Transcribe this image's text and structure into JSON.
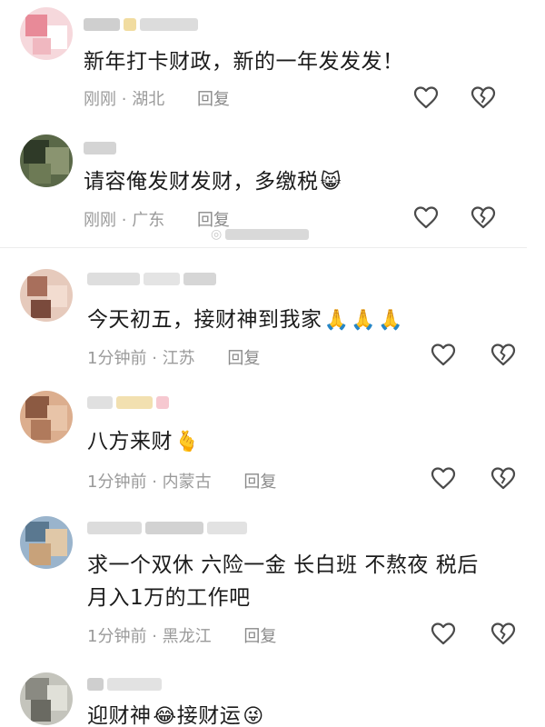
{
  "comments": [
    {
      "text_lines": [
        "新年打卡财政，新的一年发发发！"
      ],
      "time": "刚刚",
      "location": "湖北",
      "reply_label": "回复",
      "emojis": [],
      "avatar_colors": [
        "#f0b8c0",
        "#e88a98",
        "#ffffff",
        "#f5d4d8"
      ]
    },
    {
      "text_lines": [
        "请容俺发财发财，多缴税"
      ],
      "time": "刚刚",
      "location": "广东",
      "reply_label": "回复",
      "emojis": [
        "😸"
      ],
      "avatar_colors": [
        "#4b5a3c",
        "#6d7a55",
        "#2f3a28",
        "#8a9470"
      ]
    },
    {
      "text_lines": [
        "今天初五，接财神到我家"
      ],
      "time": "1分钟前",
      "location": "江苏",
      "reply_label": "回复",
      "emojis": [
        "🙏",
        "🙏",
        "🙏"
      ],
      "avatar_colors": [
        "#d9b8a8",
        "#a86f5c",
        "#f2dcd0",
        "#7a4a3c"
      ]
    },
    {
      "text_lines": [
        "八方来财"
      ],
      "time": "1分钟前",
      "location": "内蒙古",
      "reply_label": "回复",
      "emojis": [
        "🫰"
      ],
      "avatar_colors": [
        "#d6a27e",
        "#8c5a42",
        "#e8c4a8",
        "#b07a5c"
      ]
    },
    {
      "text_lines": [
        "求一个双休 六险一金 长白班 不熬夜 税后",
        "月入1万的工作吧"
      ],
      "time": "1分钟前",
      "location": "黑龙江",
      "reply_label": "回复",
      "emojis": [],
      "avatar_colors": [
        "#7fa4c4",
        "#c8a27a",
        "#5a7890",
        "#e0c8a8"
      ]
    },
    {
      "text_lines": [
        "迎财神"
      ],
      "time": "",
      "location": "",
      "reply_label": "",
      "emojis": [
        "😂"
      ],
      "text_after": "接财运",
      "emojis_after": [
        "😜"
      ],
      "avatar_colors": [
        "#b8b8b0",
        "#8a8a82",
        "#e0e0d8",
        "#6a6a62"
      ]
    }
  ],
  "separator": "·",
  "icons": {
    "like": "heart-outline-icon",
    "dislike": "broken-heart-icon"
  }
}
